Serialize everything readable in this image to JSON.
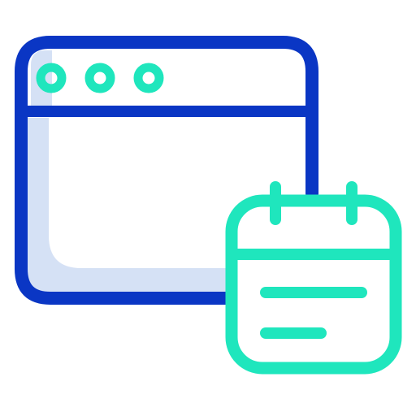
{
  "icon": {
    "name": "browser-window-with-calendar-icon",
    "colors": {
      "window_outline": "#0a36c4",
      "window_shade": "#d5e1f5",
      "accent_teal": "#1fe6bd",
      "background": "#ffffff"
    },
    "parts": {
      "window": "browser-window-icon",
      "window_dots": [
        "dot-icon",
        "dot-icon",
        "dot-icon"
      ],
      "calendar": "calendar-icon"
    }
  }
}
